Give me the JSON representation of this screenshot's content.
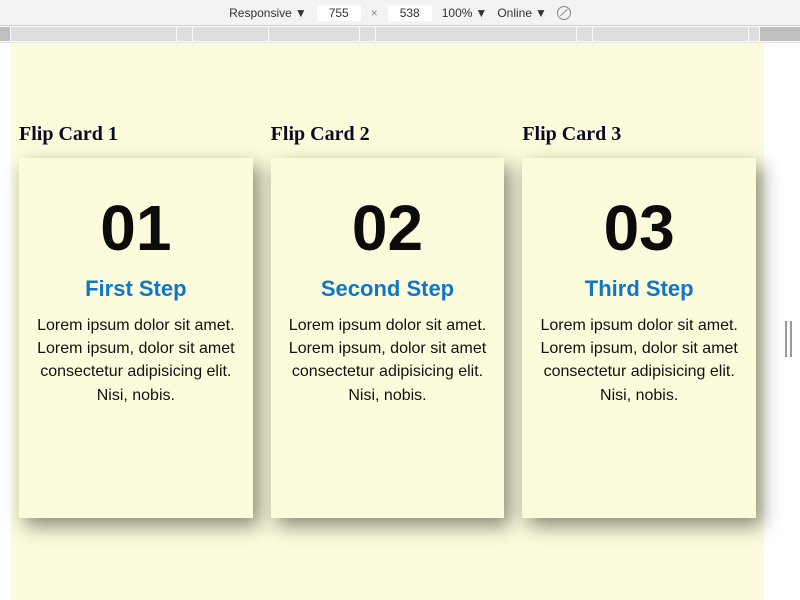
{
  "devtools": {
    "mode": "Responsive",
    "width": "755",
    "height": "538",
    "zoom": "100%",
    "throttle": "Online"
  },
  "cards": [
    {
      "heading": "Flip Card 1",
      "number": "01",
      "subtitle": "First Step",
      "body": "Lorem ipsum dolor sit amet. Lorem ipsum, dolor sit amet consectetur adipisicing elit. Nisi, nobis."
    },
    {
      "heading": "Flip Card 2",
      "number": "02",
      "subtitle": "Second Step",
      "body": "Lorem ipsum dolor sit amet. Lorem ipsum, dolor sit amet consectetur adipisicing elit. Nisi, nobis."
    },
    {
      "heading": "Flip Card 3",
      "number": "03",
      "subtitle": "Third Step",
      "body": "Lorem ipsum dolor sit amet. Lorem ipsum, dolor sit amet consectetur adipisicing elit. Nisi, nobis."
    }
  ]
}
